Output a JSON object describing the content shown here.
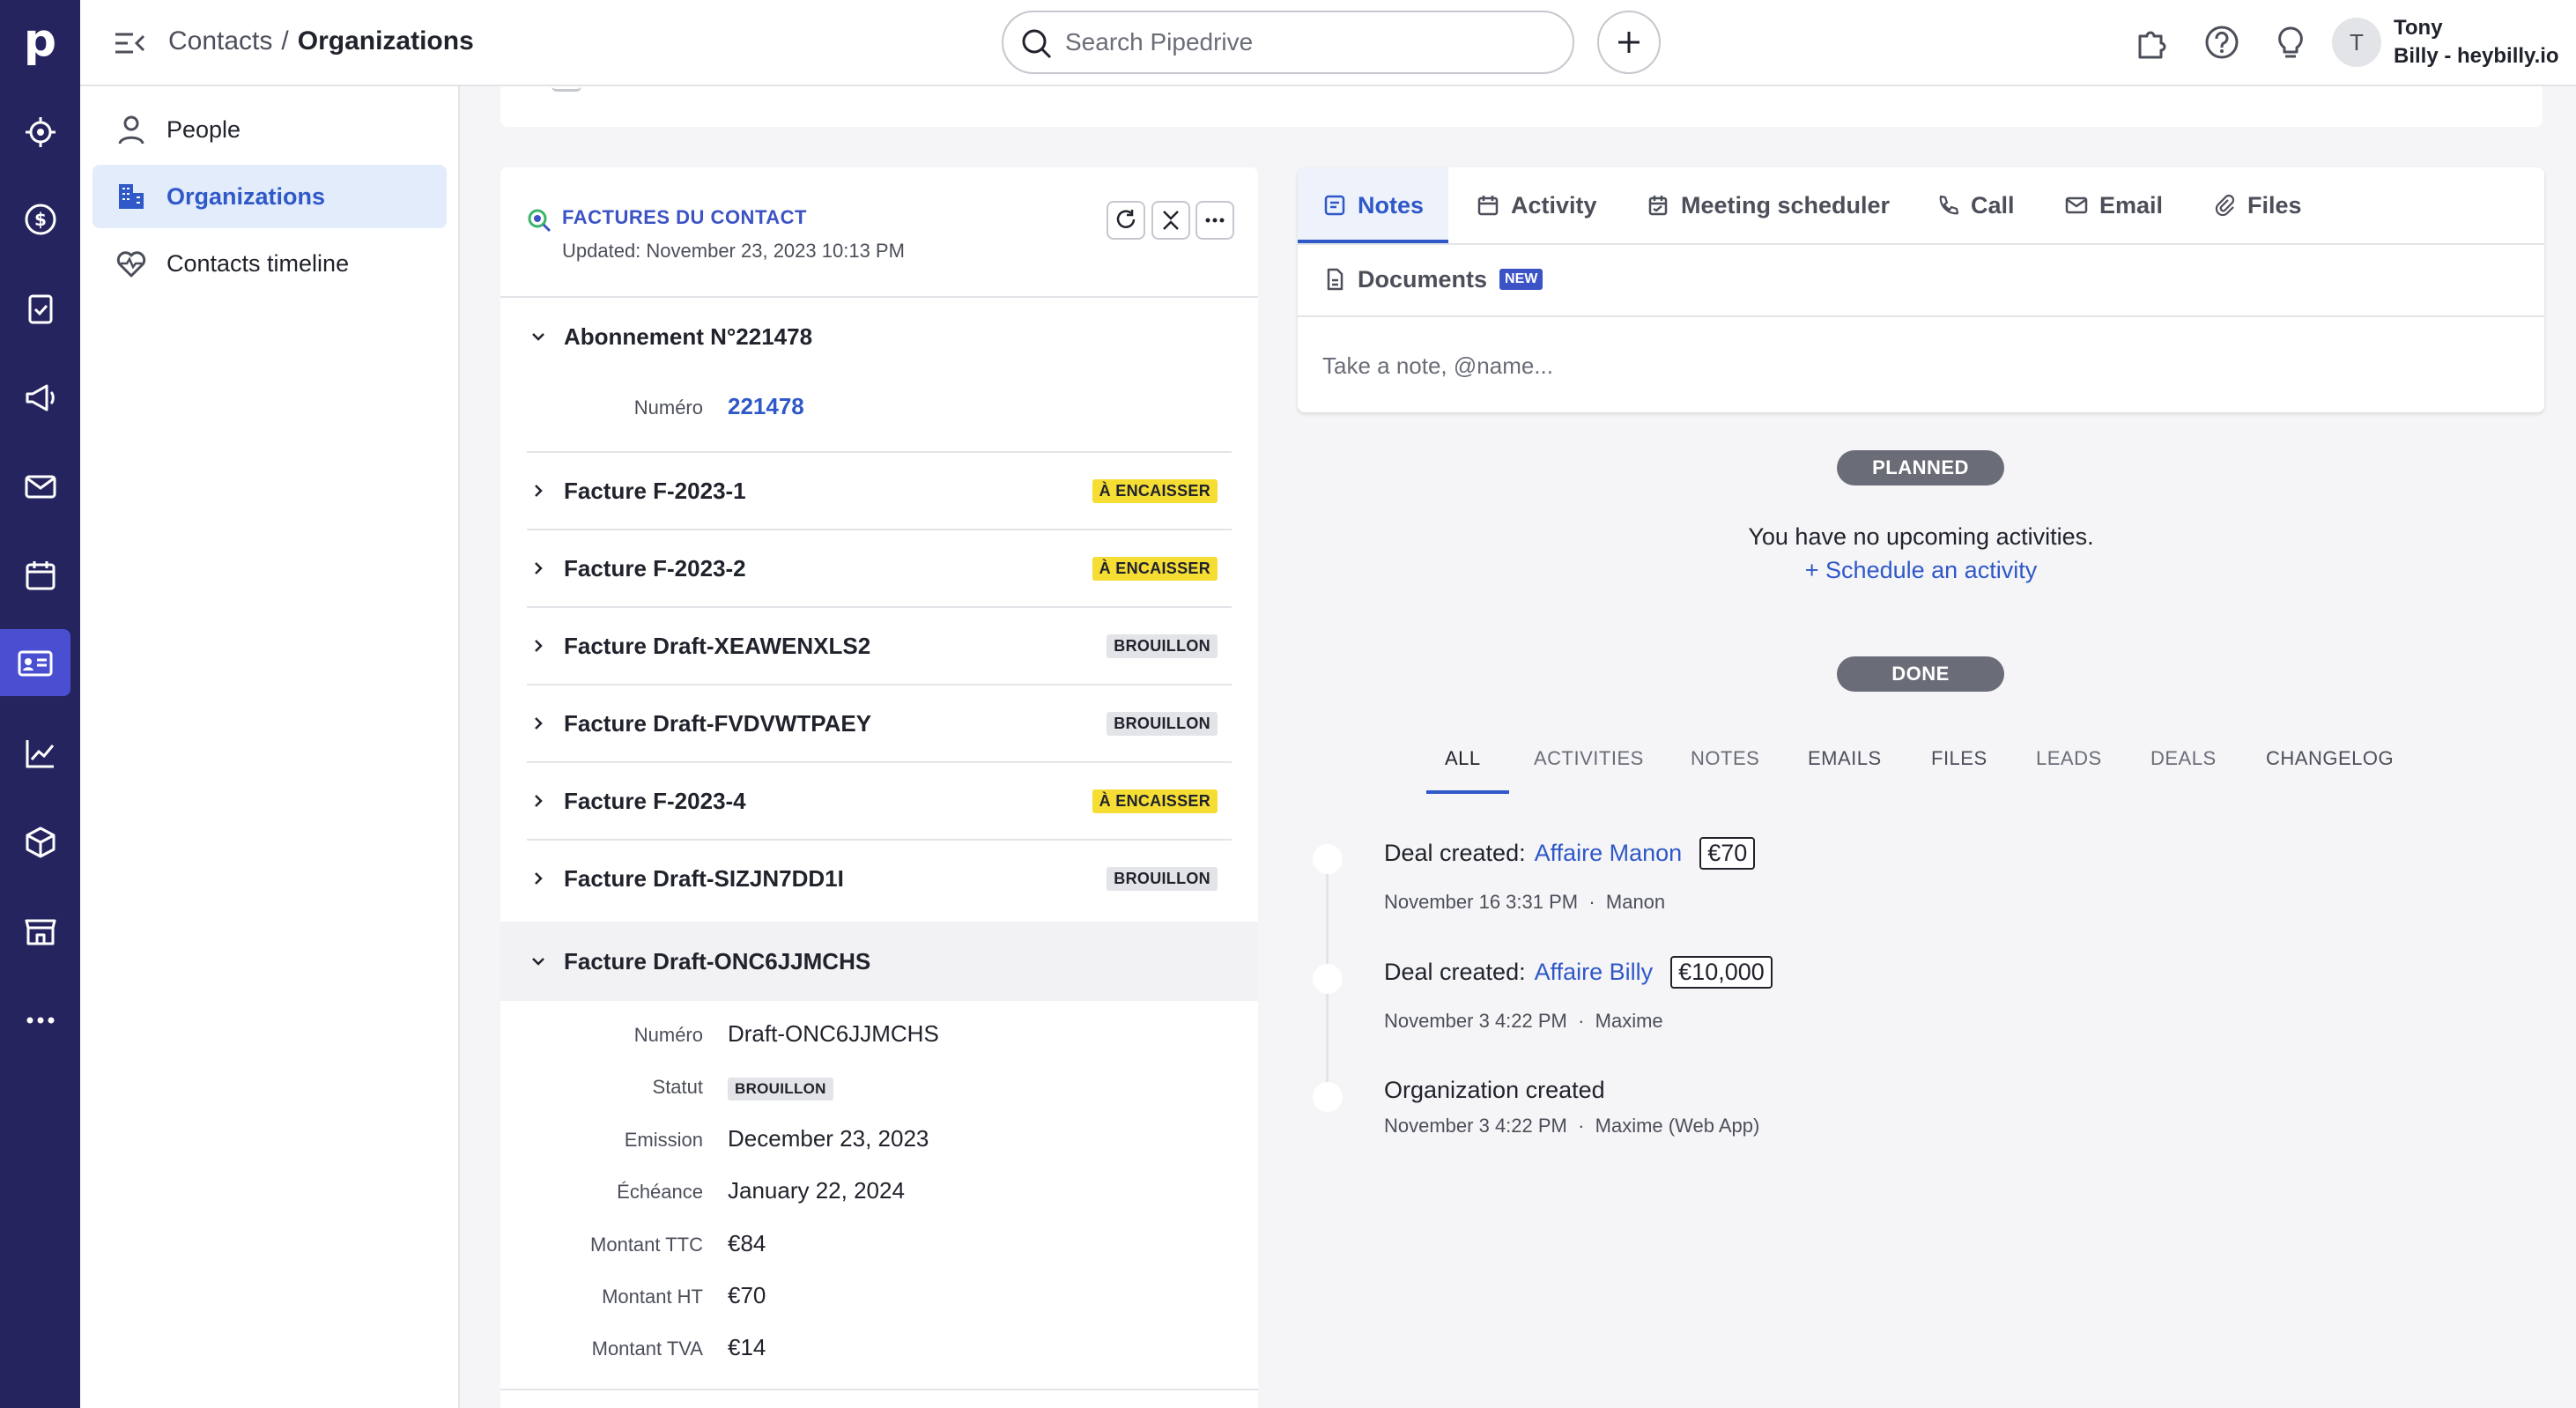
{
  "topbar": {
    "breadcrumb_parent": "Contacts",
    "breadcrumb_sep": "/",
    "breadcrumb_current": "Organizations",
    "search_placeholder": "Search Pipedrive",
    "avatar_initial": "T",
    "user_name": "Tony",
    "company": "Billy - heybilly.io"
  },
  "rail": {
    "logo": "p",
    "icons": [
      "leads-icon",
      "deals-icon",
      "activities-icon",
      "campaigns-icon",
      "mail-icon",
      "calendar-icon",
      "contacts-icon",
      "insights-icon",
      "products-icon",
      "marketplace-icon",
      "more-icon"
    ]
  },
  "subnav": {
    "items": [
      {
        "label": "People",
        "icon": "person-icon"
      },
      {
        "label": "Organizations",
        "icon": "building-icon",
        "active": true
      },
      {
        "label": "Contacts timeline",
        "icon": "heart-pulse-icon"
      }
    ]
  },
  "factures": {
    "title": "FACTURES DU CONTACT",
    "updated": "Updated: November 23, 2023 10:13 PM",
    "abonnement": {
      "label": "Abonnement N°221478",
      "numero_key": "Numéro",
      "numero_val": "221478"
    },
    "invoices": [
      {
        "label": "Facture F-2023-1",
        "status": "À ENCAISSER",
        "color": "yellow"
      },
      {
        "label": "Facture F-2023-2",
        "status": "À ENCAISSER",
        "color": "yellow"
      },
      {
        "label": "Facture Draft-XEAWENXLS2",
        "status": "BROUILLON",
        "color": "grey"
      },
      {
        "label": "Facture Draft-FVDVWTPAEY",
        "status": "BROUILLON",
        "color": "grey"
      },
      {
        "label": "Facture F-2023-4",
        "status": "À ENCAISSER",
        "color": "yellow"
      },
      {
        "label": "Facture Draft-SIZJN7DD1I",
        "status": "BROUILLON",
        "color": "grey"
      }
    ],
    "expanded": {
      "label": "Facture Draft-ONC6JJMCHS",
      "fields": [
        {
          "key": "Numéro",
          "value": "Draft-ONC6JJMCHS"
        },
        {
          "key": "Statut",
          "value": "BROUILLON"
        },
        {
          "key": "Emission",
          "value": "December 23, 2023"
        },
        {
          "key": "Échéance",
          "value": "January 22, 2024"
        },
        {
          "key": "Montant TTC",
          "value": "€84"
        },
        {
          "key": "Montant HT",
          "value": "€70"
        },
        {
          "key": "Montant TVA",
          "value": "€14"
        }
      ]
    }
  },
  "notes_panel": {
    "tabs": [
      "Notes",
      "Activity",
      "Meeting scheduler",
      "Call",
      "Email",
      "Files"
    ],
    "documents_tab": "Documents",
    "new_badge": "NEW",
    "note_placeholder": "Take a note, @name..."
  },
  "activities": {
    "planned": "PLANNED",
    "no_upcoming": "You have no upcoming activities.",
    "schedule_link": "+ Schedule an activity",
    "done": "DONE"
  },
  "history": {
    "filters": [
      "ALL",
      "ACTIVITIES",
      "NOTES",
      "EMAILS",
      "FILES",
      "LEADS",
      "DEALS",
      "CHANGELOG"
    ],
    "events": [
      {
        "prefix": "Deal created:",
        "link": "Affaire Manon",
        "amount": "€70",
        "meta": "November 16 3:31 PM  ·  Manon"
      },
      {
        "prefix": "Deal created:",
        "link": "Affaire Billy",
        "amount": "€10,000",
        "meta": "November 3 4:22 PM  ·  Maxime"
      },
      {
        "prefix": "Organization created",
        "meta": "November 3 4:22 PM  ·  Maxime (Web App)"
      }
    ]
  },
  "colors": {
    "rail": "#26245f",
    "rail_active": "#4a4fd1",
    "accent": "#2f58c8",
    "badge_yellow": "#f5dd34"
  }
}
